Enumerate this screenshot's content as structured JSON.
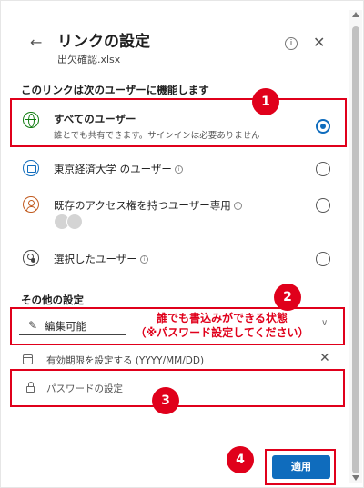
{
  "header": {
    "back_icon": "arrow-left-icon",
    "title": "リンクの設定",
    "filename": "出欠確認.xlsx",
    "info_icon": "info-icon",
    "close_icon": "close-icon"
  },
  "link_section": {
    "heading": "このリンクは次のユーザーに機能します",
    "options": [
      {
        "label": "すべてのユーザー",
        "desc": "誰とでも共有できます。サインインは必要ありません",
        "icon": "globe-icon",
        "selected": true
      },
      {
        "label": "東京経済大学 のユーザー",
        "icon": "organization-icon",
        "selected": false
      },
      {
        "label": "既存のアクセス権を持つユーザー専用",
        "icon": "person-icon",
        "selected": false
      },
      {
        "label": "選択したユーザー",
        "icon": "select-person-icon",
        "selected": false
      }
    ]
  },
  "other_settings": {
    "heading": "その他の設定",
    "permission_value": "編集可能",
    "note_line1": "誰でも書込みができる状態",
    "note_line2": "（※パスワード設定してください）",
    "expiry_label": "有効期限を設定する (YYYY/MM/DD)",
    "password_placeholder": "パスワードの設定"
  },
  "apply_label": "適用",
  "annotations": {
    "badge1": "1",
    "badge2": "2",
    "badge3": "3",
    "badge4": "4",
    "color": "#e0001b"
  },
  "colors": {
    "accent": "#0f6cbd",
    "annotation": "#e0001b"
  }
}
